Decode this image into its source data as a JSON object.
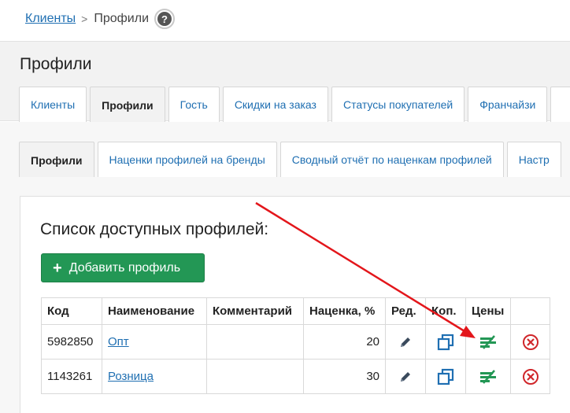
{
  "breadcrumb": {
    "root": "Клиенты",
    "separator": ">",
    "current": "Профили",
    "help": "?"
  },
  "page": {
    "title": "Профили"
  },
  "tabs_main": [
    "Клиенты",
    "Профили",
    "Гость",
    "Скидки на заказ",
    "Статусы покупателей",
    "Франчайзи",
    ""
  ],
  "tabs_sub": [
    "Профили",
    "Наценки профилей на бренды",
    "Сводный отчёт по наценкам профилей",
    "Настр"
  ],
  "list": {
    "title": "Список доступных профилей:",
    "add_button": "Добавить профиль",
    "headers": [
      "Код",
      "Наименование",
      "Комментарий",
      "Наценка, %",
      "Ред.",
      "Коп.",
      "Цены",
      ""
    ],
    "rows": [
      {
        "code": "5982850",
        "name": "Опт",
        "comment": "",
        "markup": "20"
      },
      {
        "code": "1143261",
        "name": "Розница",
        "comment": "",
        "markup": "30"
      }
    ]
  },
  "colors": {
    "link": "#1f6fb2",
    "button_green": "#239755",
    "delete_red": "#d0262a",
    "annotation_arrow": "#e3161b"
  }
}
